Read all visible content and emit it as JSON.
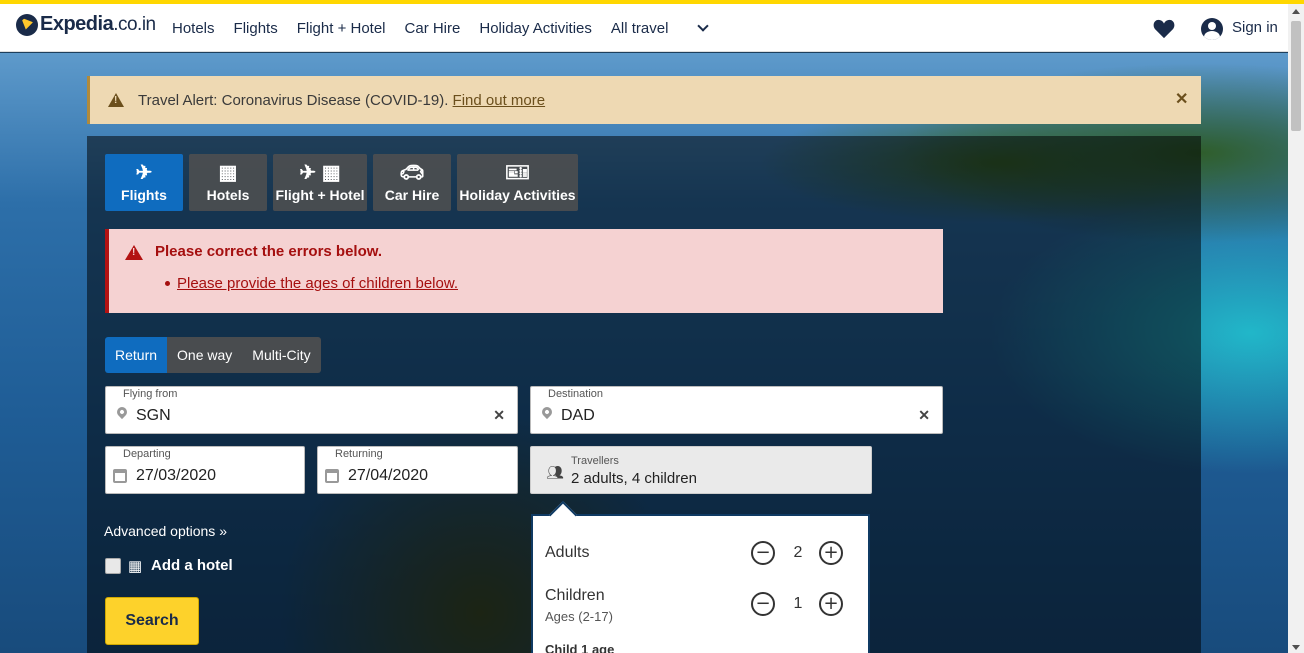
{
  "header": {
    "logo_text": "Expedia",
    "logo_tld": ".co.in",
    "nav": [
      "Hotels",
      "Flights",
      "Flight + Hotel",
      "Car Hire",
      "Holiday Activities",
      "All travel"
    ],
    "favourites_icon": "heart-icon",
    "account_icon": "user-icon",
    "signin_label": "Sign in"
  },
  "alert": {
    "text": "Travel Alert: Coronavirus Disease (COVID-19).",
    "link": "Find out more",
    "close_icon": "close-icon"
  },
  "tabs": [
    {
      "label": "Flights",
      "icon": "plane-icon",
      "active": true
    },
    {
      "label": "Hotels",
      "icon": "building-icon",
      "active": false
    },
    {
      "label": "Flight + Hotel",
      "icon": "plane-building-icon",
      "active": false
    },
    {
      "label": "Car Hire",
      "icon": "car-icon",
      "active": false
    },
    {
      "label": "Holiday Activities",
      "icon": "ticket-icon",
      "active": false
    }
  ],
  "errors": {
    "title": "Please correct the errors below.",
    "items": [
      "Please provide the ages of children below."
    ]
  },
  "trip_type": {
    "options": [
      "Return",
      "One way",
      "Multi-City"
    ],
    "selected": "Return"
  },
  "form": {
    "from_label": "Flying from",
    "from_value": "SGN",
    "to_label": "Destination",
    "to_value": "DAD",
    "depart_label": "Departing",
    "depart_value": "27/03/2020",
    "return_label": "Returning",
    "return_value": "27/04/2020",
    "travellers_label": "Travellers",
    "travellers_value": "2 adults, 4 children"
  },
  "advanced_options": "Advanced options",
  "add_hotel_label": "Add a hotel",
  "search_label": "Search",
  "travellers_popup": {
    "adults_label": "Adults",
    "adults_count": "2",
    "children_label": "Children",
    "children_ages": "Ages (2-17)",
    "children_count": "1",
    "child_age_label": "Child 1 age"
  },
  "colors": {
    "brand_navy": "#1a2b49",
    "brand_yellow": "#fdd22b",
    "active_blue": "#0f6cbf",
    "error_red": "#a50f0f"
  }
}
